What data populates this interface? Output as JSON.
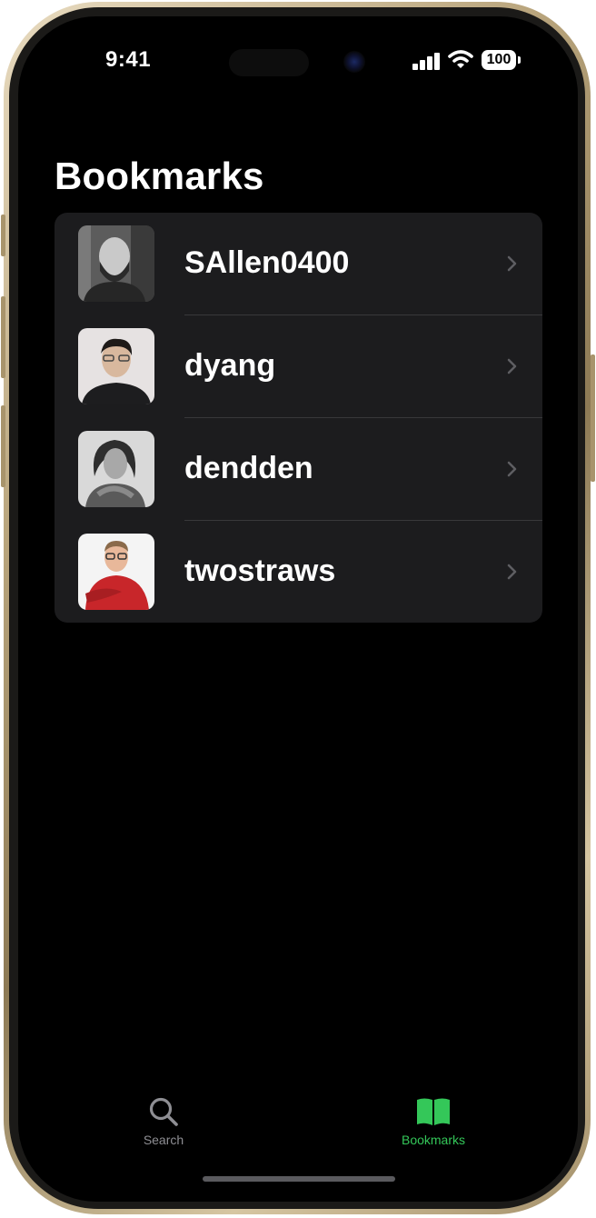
{
  "status_bar": {
    "time": "9:41",
    "battery": "100"
  },
  "page": {
    "title": "Bookmarks"
  },
  "bookmarks": [
    {
      "username": "SAllen0400"
    },
    {
      "username": "dyang"
    },
    {
      "username": "dendden"
    },
    {
      "username": "twostraws"
    }
  ],
  "tab_bar": {
    "tabs": [
      {
        "label": "Search",
        "icon": "magnifying-glass",
        "selected": false
      },
      {
        "label": "Bookmarks",
        "icon": "open-book",
        "selected": true
      }
    ]
  },
  "colors": {
    "accent": "#34c759",
    "background": "#000000",
    "list_background": "#1c1c1e",
    "inactive_tab": "#8e8e93"
  }
}
